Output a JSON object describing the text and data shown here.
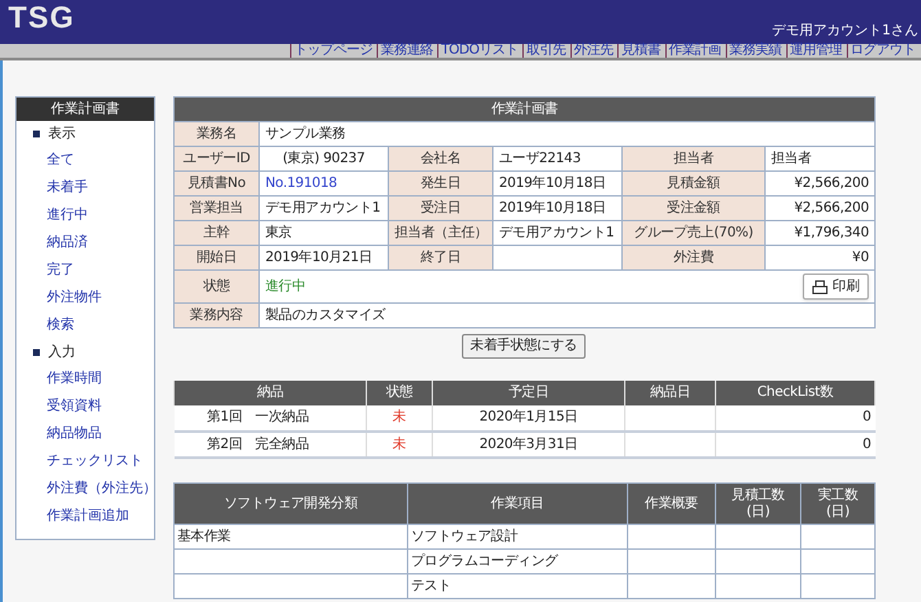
{
  "header": {
    "logo": "TSG",
    "user": "デモ用アカウント1さん"
  },
  "nav": [
    "トップページ",
    "業務連絡",
    "TODOリスト",
    "取引先",
    "外注先",
    "見積書",
    "作業計画",
    "業務実績",
    "運用管理",
    "ログアウト"
  ],
  "sidebar": {
    "title": "作業計画書",
    "sections": [
      {
        "label": "表示",
        "children": [
          {
            "label": "全て"
          },
          {
            "label": "未着手"
          },
          {
            "label": "進行中"
          },
          {
            "label": "納品済"
          },
          {
            "label": "完了"
          },
          {
            "label": "外注物件"
          },
          {
            "label": "検索"
          }
        ]
      },
      {
        "label": "入力",
        "children": [
          {
            "label": "作業時間"
          },
          {
            "label": "受領資料"
          },
          {
            "label": "納品物品"
          },
          {
            "label": "チェックリスト"
          },
          {
            "label": "外注費（外注先）"
          },
          {
            "label": "作業計画追加"
          }
        ]
      }
    ]
  },
  "plan": {
    "title": "作業計画書",
    "rows": [
      {
        "cells": [
          {
            "kind": "label",
            "text": "業務名"
          },
          {
            "kind": "value",
            "text": "サンプル業務",
            "colspan": 5
          }
        ]
      },
      {
        "cells": [
          {
            "kind": "label",
            "text": "ユーザーID"
          },
          {
            "kind": "center",
            "text": "(東京) 90237"
          },
          {
            "kind": "label",
            "text": "会社名"
          },
          {
            "kind": "value",
            "text": "ユーザ22143"
          },
          {
            "kind": "label",
            "text": "担当者"
          },
          {
            "kind": "value",
            "text": "担当者"
          }
        ]
      },
      {
        "cells": [
          {
            "kind": "label",
            "text": "見積書No"
          },
          {
            "kind": "link",
            "text": "No.191018"
          },
          {
            "kind": "label",
            "text": "発生日"
          },
          {
            "kind": "value",
            "text": "2019年10月18日"
          },
          {
            "kind": "label",
            "text": "見積金額"
          },
          {
            "kind": "amount",
            "text": "¥2,566,200"
          }
        ]
      },
      {
        "cells": [
          {
            "kind": "label",
            "text": "営業担当"
          },
          {
            "kind": "value",
            "text": "デモ用アカウント1"
          },
          {
            "kind": "label",
            "text": "受注日"
          },
          {
            "kind": "value",
            "text": "2019年10月18日"
          },
          {
            "kind": "label",
            "text": "受注金額"
          },
          {
            "kind": "amount",
            "text": "¥2,566,200"
          }
        ]
      },
      {
        "cells": [
          {
            "kind": "label",
            "text": "主幹"
          },
          {
            "kind": "value",
            "text": "東京"
          },
          {
            "kind": "label",
            "text": "担当者（主任）"
          },
          {
            "kind": "value",
            "text": "デモ用アカウント1"
          },
          {
            "kind": "label",
            "text": "グループ売上(70%)"
          },
          {
            "kind": "amount",
            "text": "¥1,796,340"
          }
        ]
      },
      {
        "cells": [
          {
            "kind": "label",
            "text": "開始日"
          },
          {
            "kind": "value",
            "text": "2019年10月21日"
          },
          {
            "kind": "label",
            "text": "終了日"
          },
          {
            "kind": "value",
            "text": ""
          },
          {
            "kind": "label",
            "text": "外注費"
          },
          {
            "kind": "amount",
            "text": "¥0"
          }
        ]
      },
      {
        "cells": [
          {
            "kind": "label",
            "text": "状態"
          },
          {
            "kind": "status",
            "text": "進行中",
            "colspan": 5
          }
        ],
        "button": "印刷"
      },
      {
        "cells": [
          {
            "kind": "label",
            "text": "業務内容"
          },
          {
            "kind": "value",
            "text": "製品のカスタマイズ",
            "colspan": 5
          }
        ]
      }
    ],
    "action": "未着手状態にする"
  },
  "deliveries": {
    "columns": [
      "納品",
      "状態",
      "予定日",
      "納品日",
      "CheckList数"
    ],
    "rows": [
      {
        "name": "第1回　一次納品",
        "status": "未",
        "due": "2020年1月15日",
        "count": "0"
      },
      {
        "name": "第2回　完全納品",
        "status": "未",
        "due": "2020年3月31日",
        "count": "0"
      }
    ]
  },
  "tasks": {
    "columns": [
      "ソフトウェア開発分類",
      "作業項目",
      "作業概要",
      "見積工数\n(日)",
      "実工数\n(日)"
    ],
    "rows": [
      {
        "category": "基本作業",
        "item": "ソフトウェア設計"
      },
      {
        "category": "",
        "item": "プログラムコーディング"
      },
      {
        "category": "",
        "item": "テスト"
      }
    ]
  }
}
